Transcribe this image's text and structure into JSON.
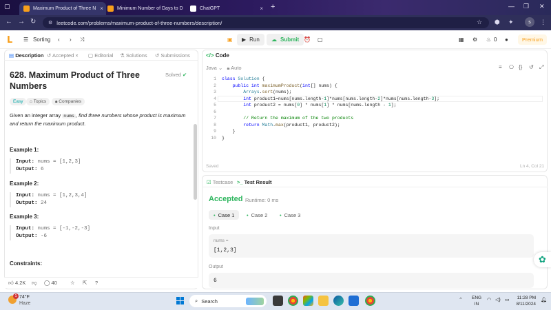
{
  "browser": {
    "tabs": [
      {
        "title": "Maximum Product of Three N",
        "active": true
      },
      {
        "title": "Minimum Number of Days to D",
        "active": false
      },
      {
        "title": "ChatGPT",
        "active": false
      }
    ],
    "url": "leetcode.com/problems/maximum-product-of-three-numbers/description/",
    "profile_initial": "s"
  },
  "lc_header": {
    "problem_list": "Sorting",
    "run_label": "Run",
    "submit_label": "Submit",
    "coins": "0",
    "premium_label": "Premium"
  },
  "left_tabs": [
    "Description",
    "Accepted",
    "Editorial",
    "Solutions",
    "Submissions"
  ],
  "problem": {
    "title": "628. Maximum Product of Three Numbers",
    "solved": "Solved",
    "difficulty": "Easy",
    "topics": "Topics",
    "companies": "Companies",
    "desc_pre": "Given an integer array ",
    "desc_code": "nums",
    "desc_post": ", find three numbers whose product is maximum and return the maximum product.",
    "examples": [
      {
        "head": "Example 1:",
        "input_label": "Input:",
        "input": "nums = [1,2,3]",
        "output_label": "Output:",
        "output": "6"
      },
      {
        "head": "Example 2:",
        "input_label": "Input:",
        "input": "nums = [1,2,3,4]",
        "output_label": "Output:",
        "output": "24"
      },
      {
        "head": "Example 3:",
        "input_label": "Input:",
        "input": "nums = [-1,-2,-3]",
        "output_label": "Output:",
        "output": "-6"
      }
    ],
    "constraints_head": "Constraints:"
  },
  "footer": {
    "likes": "4.2K",
    "comments": "40"
  },
  "editor": {
    "panel_title": "Code",
    "language": "Java",
    "mode": "Auto",
    "saved": "Saved",
    "cursor": "Ln 4, Col 21",
    "line_numbers": [
      "1",
      "2",
      "3",
      "4",
      "5",
      "6",
      "7",
      "8",
      "9",
      "10"
    ]
  },
  "results": {
    "tabs": [
      "Testcase",
      "Test Result"
    ],
    "status": "Accepted",
    "runtime": "Runtime: 0 ms",
    "cases": [
      "Case 1",
      "Case 2",
      "Case 3"
    ],
    "input_label": "Input",
    "input_key": "nums =",
    "input_value": "[1,2,3]",
    "output_label": "Output",
    "output_value": "6"
  },
  "taskbar": {
    "temp": "74°F",
    "weather": "Haze",
    "weather_badge": "1",
    "search_placeholder": "Search",
    "lang_top": "ENG",
    "lang_bottom": "IN",
    "time": "11:28 PM",
    "date": "8/11/2024"
  },
  "colors": {
    "accent_green": "#2db55d",
    "leetcode_orange": "#f89f1b",
    "browser_bg": "#2c1a5e"
  }
}
